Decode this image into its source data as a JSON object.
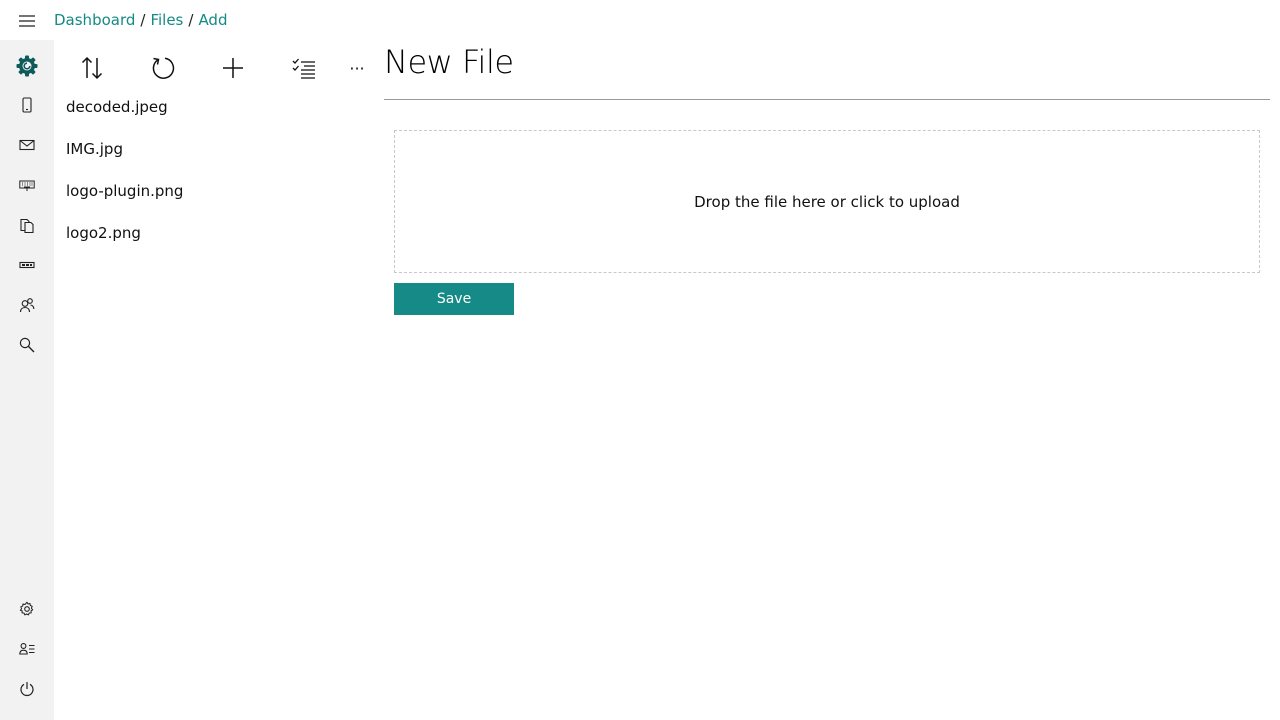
{
  "breadcrumb": {
    "items": [
      "Dashboard",
      "Files",
      "Add"
    ],
    "separator": "/"
  },
  "rail": {
    "top_icons": [
      "app-logo-icon",
      "device-icon",
      "mail-icon",
      "keyboard-icon",
      "copy-files-icon",
      "switch-icon",
      "users-icon",
      "search-icon"
    ],
    "bottom_icons": [
      "gear-icon",
      "user-list-icon",
      "power-icon"
    ]
  },
  "toolbar": {
    "icons": [
      "sort-icon",
      "refresh-icon",
      "add-icon",
      "select-list-icon",
      "more-icon"
    ],
    "more_glyph": "···"
  },
  "files": [
    "decoded.jpeg",
    "IMG.jpg",
    "logo-plugin.png",
    "logo2.png"
  ],
  "main": {
    "title": "New File",
    "dropzone_text": "Drop the file here or click to upload",
    "save_label": "Save"
  },
  "colors": {
    "accent": "#158a86",
    "logo": "#0d5b5b",
    "rail_background": "#f2f2f2"
  }
}
